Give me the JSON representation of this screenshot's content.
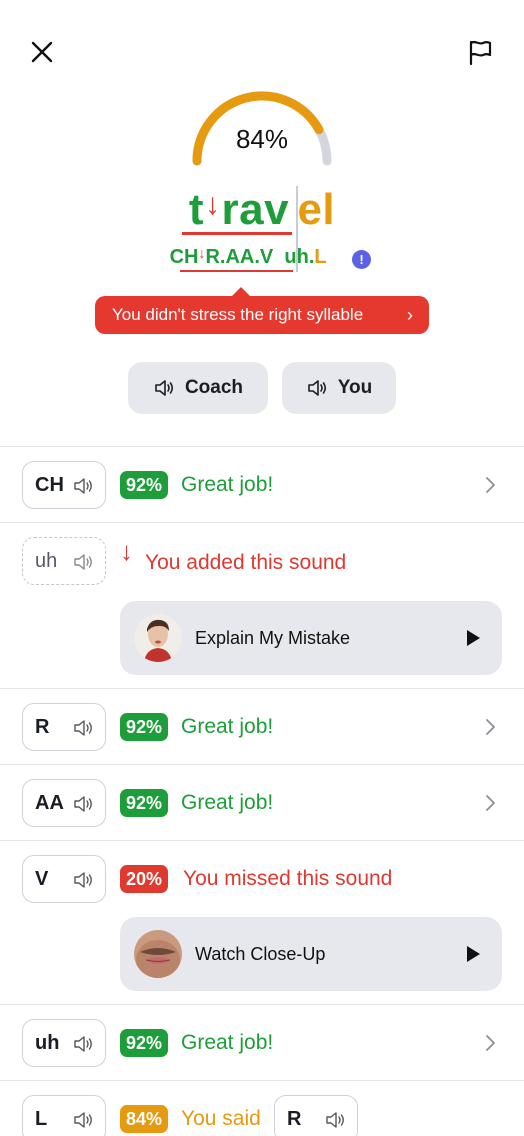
{
  "header": {
    "close_icon": "close-icon",
    "flag_icon": "flag-icon"
  },
  "score": {
    "value": 84,
    "label": "84%",
    "arc_color": "#e59a10",
    "track_color": "#d4d6dc"
  },
  "word": {
    "stress_arrow": "↓",
    "part1_first": "t",
    "part1_rest": "rav",
    "part2": "el"
  },
  "phonetic": {
    "seg1_a": "CH",
    "seg1_arrow": "↓",
    "seg1_b": "R.AA.V",
    "seg2_a": "uh.",
    "seg2_b": "L",
    "info": "!"
  },
  "tooltip": {
    "text": "You didn't stress the right syllable",
    "chevron": "›"
  },
  "buttons": {
    "coach": "Coach",
    "you": "You"
  },
  "rows": [
    {
      "phoneme": "CH",
      "score": "92%",
      "status": "Great job!"
    },
    {
      "phoneme": "uh",
      "arrow": "↓",
      "status": "You added this sound",
      "card": "Explain My Mistake"
    },
    {
      "phoneme": "R",
      "score": "92%",
      "status": "Great job!"
    },
    {
      "phoneme": "AA",
      "score": "92%",
      "status": "Great job!"
    },
    {
      "phoneme": "V",
      "score": "20%",
      "status": "You missed this sound",
      "card": "Watch Close-Up"
    },
    {
      "phoneme": "uh",
      "score": "92%",
      "status": "Great job!"
    },
    {
      "phoneme": "L",
      "score": "84%",
      "status": "You said",
      "said": "R"
    }
  ],
  "colors": {
    "green": "#1e9e3a",
    "red": "#e0392f",
    "orange": "#e59a10",
    "accent_blue": "#5a63e8",
    "pill_bg": "#e6e8ee"
  }
}
